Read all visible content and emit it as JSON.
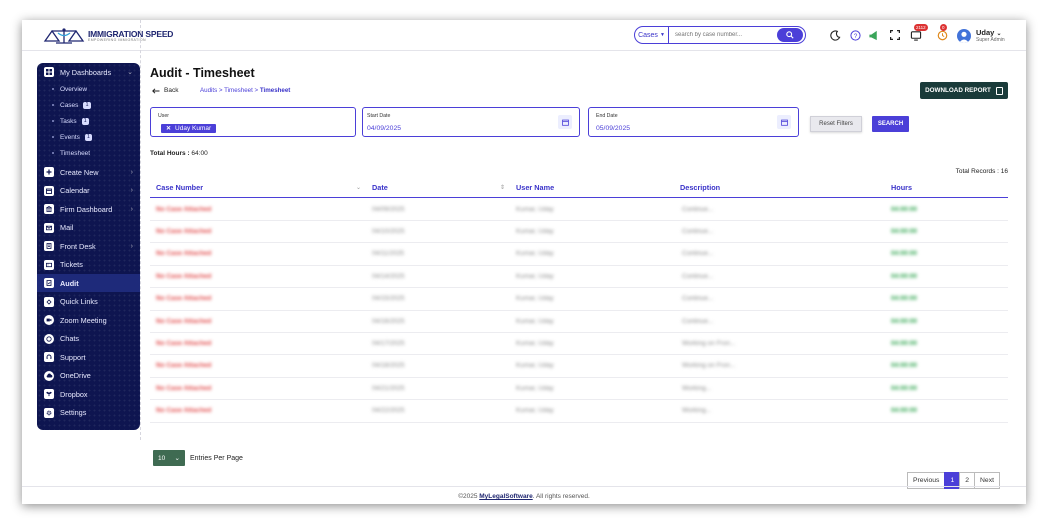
{
  "brand": {
    "name": "IMMIGRATION SPEED",
    "tagline": "EMPOWERING IMMIGRATION"
  },
  "topbar": {
    "search_scope": "Cases",
    "search_placeholder": "search by case number...",
    "notif_badge": "2112",
    "alert_badge": "0",
    "user_name": "Uday",
    "user_role": "Super Admin"
  },
  "sidebar": {
    "items": [
      {
        "label": "My Dashboards",
        "icon": "dashboard-icon"
      },
      {
        "label": "Create New",
        "icon": "plus-icon"
      },
      {
        "label": "Calendar",
        "icon": "calendar-icon"
      },
      {
        "label": "Firm Dashboard",
        "icon": "firm-icon"
      },
      {
        "label": "Mail",
        "icon": "mail-icon"
      },
      {
        "label": "Front Desk",
        "icon": "front-desk-icon"
      },
      {
        "label": "Tickets",
        "icon": "ticket-icon"
      },
      {
        "label": "Audit",
        "icon": "audit-icon"
      },
      {
        "label": "Quick Links",
        "icon": "link-icon"
      },
      {
        "label": "Zoom Meeting",
        "icon": "video-icon"
      },
      {
        "label": "Chats",
        "icon": "chat-icon"
      },
      {
        "label": "Support",
        "icon": "headset-icon"
      },
      {
        "label": "OneDrive",
        "icon": "cloud-icon"
      },
      {
        "label": "Dropbox",
        "icon": "dropbox-icon"
      },
      {
        "label": "Settings",
        "icon": "gear-icon"
      }
    ],
    "subitems": [
      {
        "label": "Overview",
        "count": ""
      },
      {
        "label": "Cases",
        "count": "1"
      },
      {
        "label": "Tasks",
        "count": "1"
      },
      {
        "label": "Events",
        "count": "1"
      },
      {
        "label": "Timesheet",
        "count": ""
      }
    ]
  },
  "page": {
    "title": "Audit - Timesheet",
    "back_label": "Back",
    "breadcrumb_prefix": "Audits > Timesheet > ",
    "breadcrumb_current": "Timesheet",
    "download_label": "DOWNLOAD REPORT"
  },
  "filters": {
    "user_label": "User",
    "user_chip": "Uday Kumar",
    "start_label": "Start Date",
    "start_value": "04/09/2025",
    "end_label": "End Date",
    "end_value": "05/09/2025",
    "reset_label": "Reset Filters",
    "search_label": "SEARCH"
  },
  "summary": {
    "total_hours_label": "Total Hours :",
    "total_hours_value": "64:00",
    "total_records": "Total Records : 16"
  },
  "table": {
    "headers": [
      "Case Number",
      "Date",
      "User Name",
      "Description",
      "Hours"
    ],
    "rows": [
      [
        "No Case Attached",
        "04/09/2025",
        "Kumar, Uday",
        "Continue...",
        "04:00:00"
      ],
      [
        "No Case Attached",
        "04/10/2025",
        "Kumar, Uday",
        "Continue...",
        "04:00:00"
      ],
      [
        "No Case Attached",
        "04/11/2025",
        "Kumar, Uday",
        "Continue...",
        "04:00:00"
      ],
      [
        "No Case Attached",
        "04/14/2025",
        "Kumar, Uday",
        "Continue...",
        "04:00:00"
      ],
      [
        "No Case Attached",
        "04/15/2025",
        "Kumar, Uday",
        "Continue...",
        "04:00:00"
      ],
      [
        "No Case Attached",
        "04/16/2025",
        "Kumar, Uday",
        "Continue...",
        "04:00:00"
      ],
      [
        "No Case Attached",
        "04/17/2025",
        "Kumar, Uday",
        "Working on Fron...",
        "04:00:00"
      ],
      [
        "No Case Attached",
        "04/18/2025",
        "Kumar, Uday",
        "Working on Fron...",
        "04:00:00"
      ],
      [
        "No Case Attached",
        "04/21/2025",
        "Kumar, Uday",
        "Working...",
        "04:00:00"
      ],
      [
        "No Case Attached",
        "04/22/2025",
        "Kumar, Uday",
        "Working...",
        "04:00:00"
      ]
    ]
  },
  "pagination": {
    "per_page": "10",
    "per_page_label": "Entries Per Page",
    "previous": "Previous",
    "pages": [
      "1",
      "2"
    ],
    "next": "Next"
  },
  "footer": {
    "prefix": "©2025 ",
    "link": "MyLegalSoftware",
    "suffix": ". All rights reserved."
  },
  "colors": {
    "accent": "#4b3fd8",
    "sidebar": "#0e1550",
    "download": "#1a3b3a",
    "case_text": "#e04444",
    "hours_text": "#2aa24a"
  }
}
